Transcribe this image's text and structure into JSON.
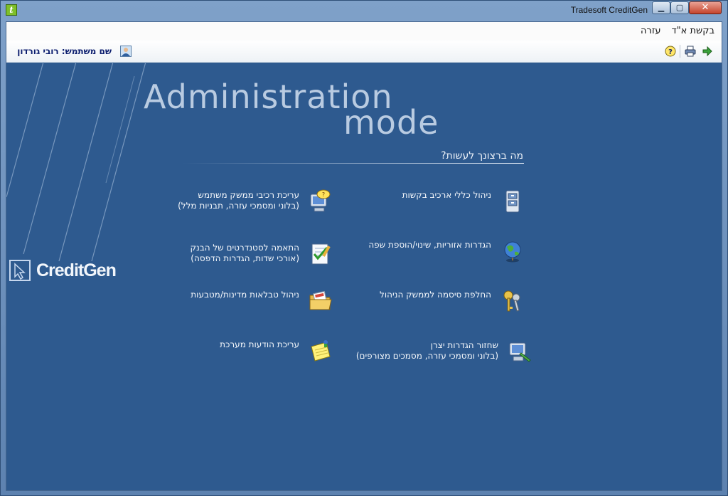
{
  "window": {
    "title": "Tradesoft CreditGen",
    "min_glyph": "▁",
    "max_glyph": "▢",
    "close_glyph": "✕"
  },
  "menu": {
    "items": [
      "בקשת א\"ד",
      "עזרה"
    ]
  },
  "toolbar": {
    "user_label": "שם משתמש: רובי גורדון"
  },
  "brand": {
    "logo_text": "CreditGen"
  },
  "main": {
    "headline_line1": "Administration",
    "headline_line2": "mode",
    "question": "מה ברצונך לעשות?",
    "actions": [
      {
        "line1": "ניהול כללי ארכיב בקשות",
        "line2": "",
        "icon": "file-cabinet-icon"
      },
      {
        "line1": "עריכת רכיבי ממשק משתמש",
        "line2": "(בלוני ומסמכי עזרה, תבניות מלל)",
        "icon": "computer-help-icon"
      },
      {
        "line1": "הגדרות אזוריות, שינוי/הוספת שפה",
        "line2": "",
        "icon": "globe-icon"
      },
      {
        "line1": "התאמה לסטנדרטים של הבנק",
        "line2": "(אורכי שדות, הגדרות הדפסה)",
        "icon": "checklist-icon"
      },
      {
        "line1": "החלפת סיסמה לממשק הניהול",
        "line2": "",
        "icon": "keys-icon"
      },
      {
        "line1": "ניהול טבלאות מדינות/מטבעות",
        "line2": "",
        "icon": "folder-icon"
      },
      {
        "line1": "שחזור הגדרות יצרן",
        "line2": "(בלוני ומסמכי עזרה, מסמכים מצורפים)",
        "icon": "restore-computer-icon"
      },
      {
        "line1": "עריכת הודעות מערכת",
        "line2": "",
        "icon": "notepad-icon"
      }
    ]
  }
}
